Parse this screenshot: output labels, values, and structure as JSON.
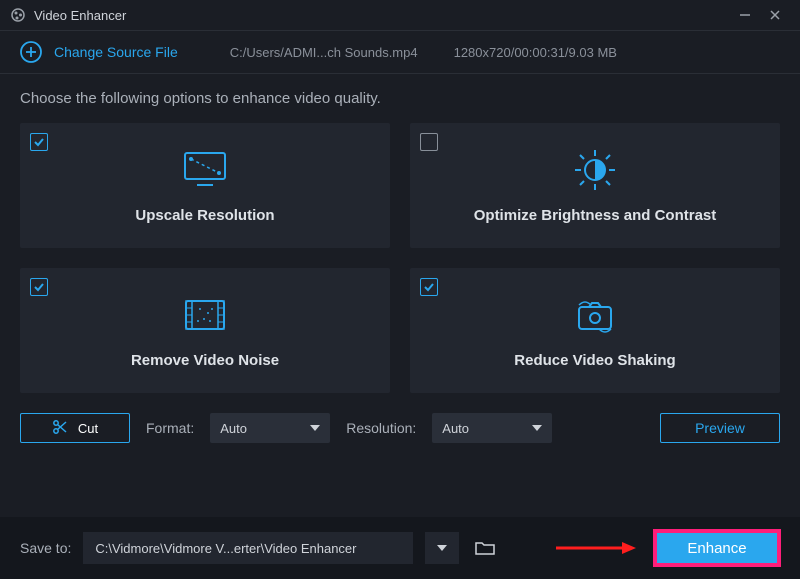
{
  "title": "Video Enhancer",
  "source": {
    "change_label": "Change Source File",
    "path": "C:/Users/ADMI...ch Sounds.mp4",
    "meta": "1280x720/00:00:31/9.03 MB"
  },
  "instruction": "Choose the following options to enhance video quality.",
  "cards": [
    {
      "label": "Upscale Resolution",
      "checked": true
    },
    {
      "label": "Optimize Brightness and Contrast",
      "checked": false
    },
    {
      "label": "Remove Video Noise",
      "checked": true
    },
    {
      "label": "Reduce Video Shaking",
      "checked": true
    }
  ],
  "controls": {
    "cut_label": "Cut",
    "format_label": "Format:",
    "format_value": "Auto",
    "resolution_label": "Resolution:",
    "resolution_value": "Auto",
    "preview_label": "Preview"
  },
  "footer": {
    "saveto_label": "Save to:",
    "path": "C:\\Vidmore\\Vidmore V...erter\\Video Enhancer",
    "enhance_label": "Enhance"
  }
}
